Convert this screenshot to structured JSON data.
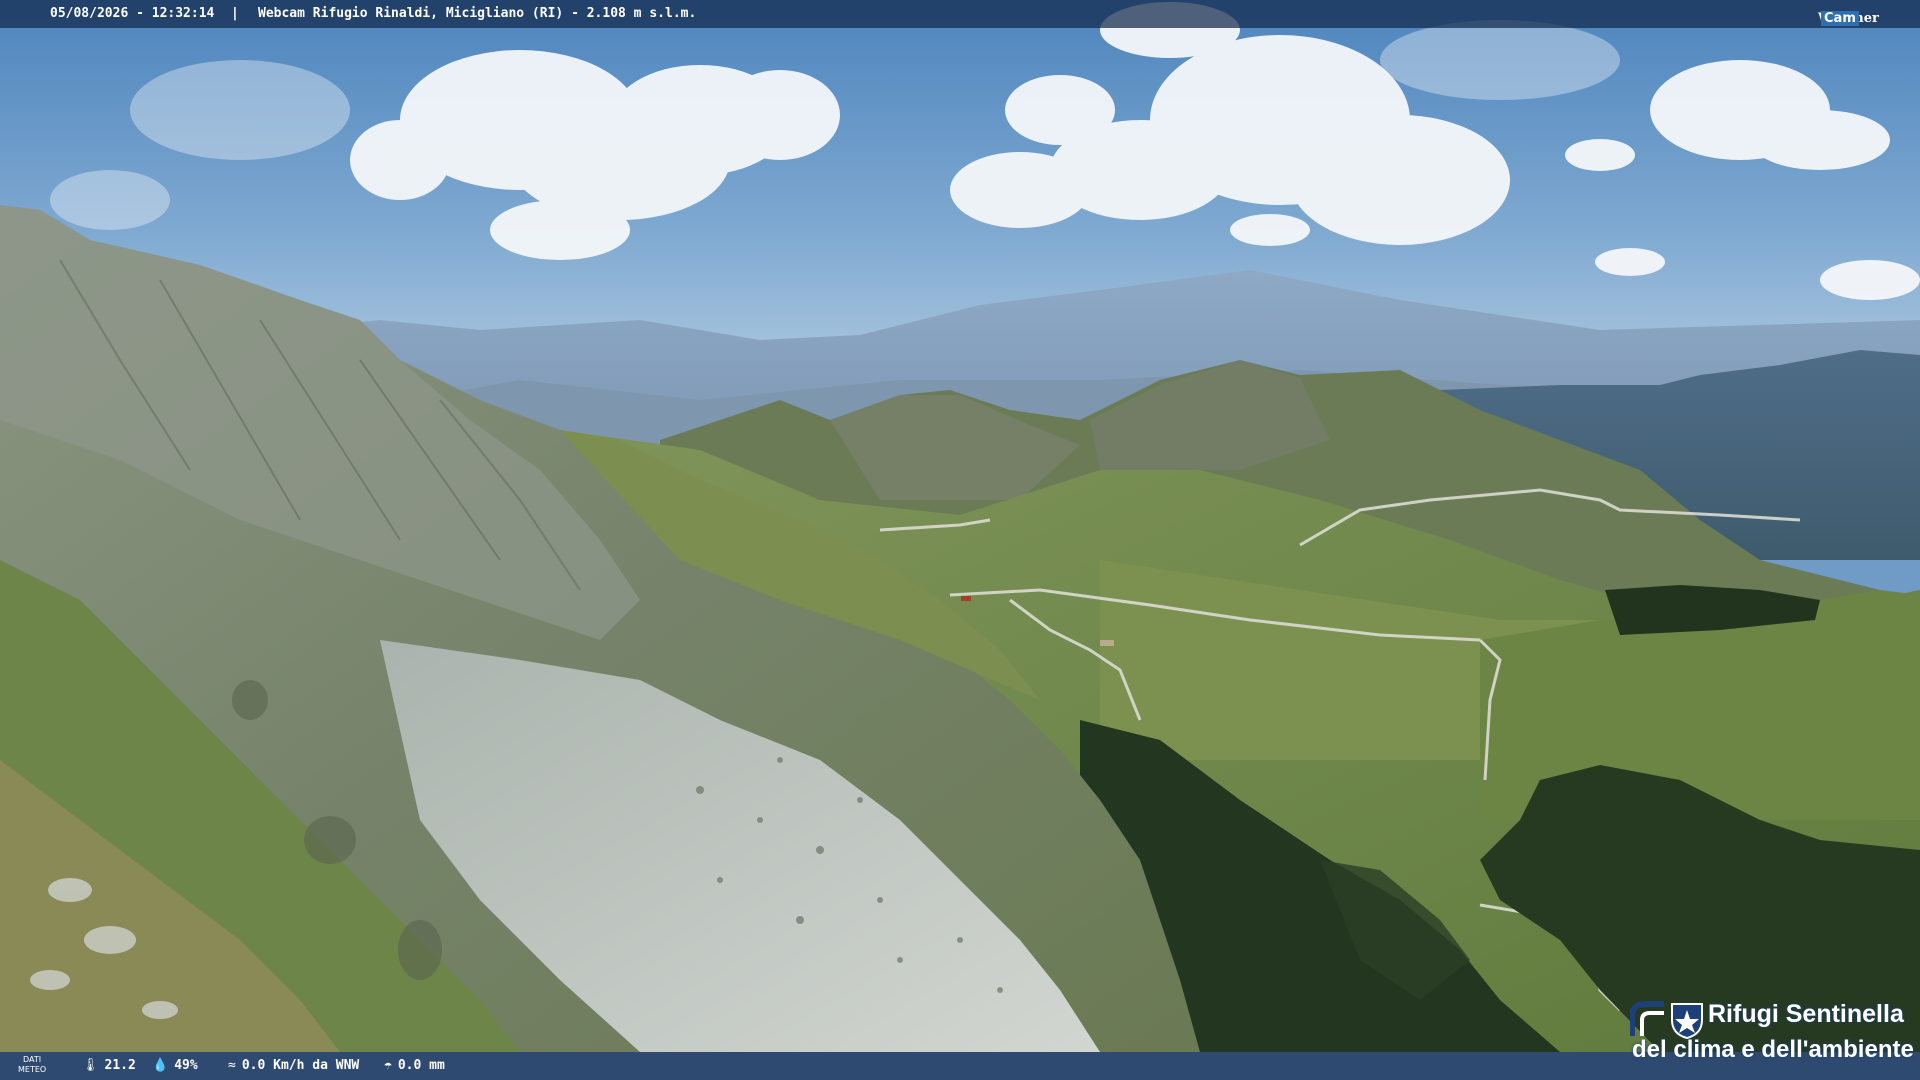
{
  "header": {
    "datetime": "05/08/2026 - 12:32:14",
    "separator": "|",
    "title": "Webcam Rifugio Rinaldi, Micigliano (RI) - 2.108 m s.l.m.",
    "brand_weather": "Weather",
    "brand_cam": "Cam"
  },
  "weather": {
    "label_line1": "DATI",
    "label_line2": "METEO",
    "temperature": "21.2",
    "humidity": "49%",
    "wind": "0.0 Km/h da WNW",
    "rain": "0.0 mm"
  },
  "logo": {
    "line1": "Rifugi Sentinella",
    "line2": "del clima e dell'ambiente"
  },
  "colors": {
    "sky_top": "#4d84bd",
    "sky_horizon": "#b9d1e3",
    "grass": "#6f8a4a",
    "forest": "#23361f",
    "scree": "#c3c9c4",
    "bar_bg": "#12284b",
    "logo_blue": "#1d3f7a"
  }
}
